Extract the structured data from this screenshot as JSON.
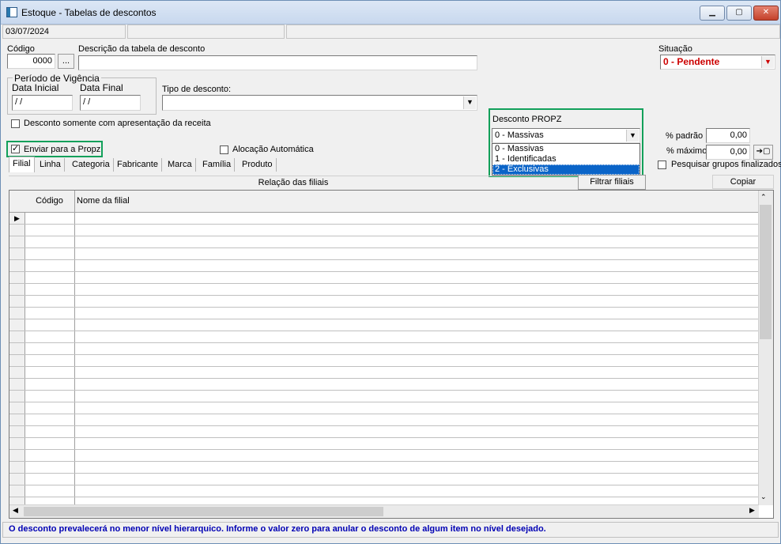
{
  "window": {
    "title": "Estoque - Tabelas de descontos",
    "minimize": "▁",
    "maximize": "▢",
    "close": "✕"
  },
  "status_top": {
    "date": "03/07/2024"
  },
  "form": {
    "codigo_label": "Código",
    "codigo_value": "0000",
    "codigo_lookup": "...",
    "descricao_label": "Descrição da tabela de desconto",
    "descricao_value": "",
    "situacao_label": "Situação",
    "situacao_value": "0 - Pendente",
    "situacao_color": "#cc0000",
    "periodo_label": "Período de Vigência",
    "data_inicial_label": "Data Inicial",
    "data_inicial_value": " / /",
    "data_final_label": "Data Final",
    "data_final_value": " / /",
    "tipo_label": "Tipo de desconto:",
    "tipo_value": "",
    "receita_label": "Desconto somente com apresentação da receita",
    "enviar_label": "Enviar para a Propz",
    "enviar_checked": true,
    "alocacao_label": "Alocação Automática",
    "propz_label": "Desconto PROPZ",
    "propz_value": "0 - Massivas",
    "propz_options": [
      "0 - Massivas",
      "1 - Identificadas",
      "2 - Exclusivas"
    ],
    "propz_highlighted_index": 2,
    "pct_padrao_label": "% padrão",
    "pct_padrao_value": "0,00",
    "pct_maximo_label": "% máximo",
    "pct_maximo_value": "0,00",
    "pesquisar_label": "Pesquisar grupos finalizados",
    "highlight_color": "#12a05a"
  },
  "tabs": [
    "Filial",
    "Linha",
    "Categoria",
    "Fabricante",
    "Marca",
    "Família",
    "Produto"
  ],
  "grid_toolbar": {
    "relacao_label": "Relação das filiais",
    "filtrar_label": "Filtrar filiais",
    "copiar_label": "Copiar"
  },
  "grid": {
    "columns": [
      "Código",
      "Nome da filial"
    ]
  },
  "footer": {
    "message": "O desconto prevalecerá no menor nível hierarquico. Informe o valor zero para anular o desconto de algum item no nível desejado."
  }
}
